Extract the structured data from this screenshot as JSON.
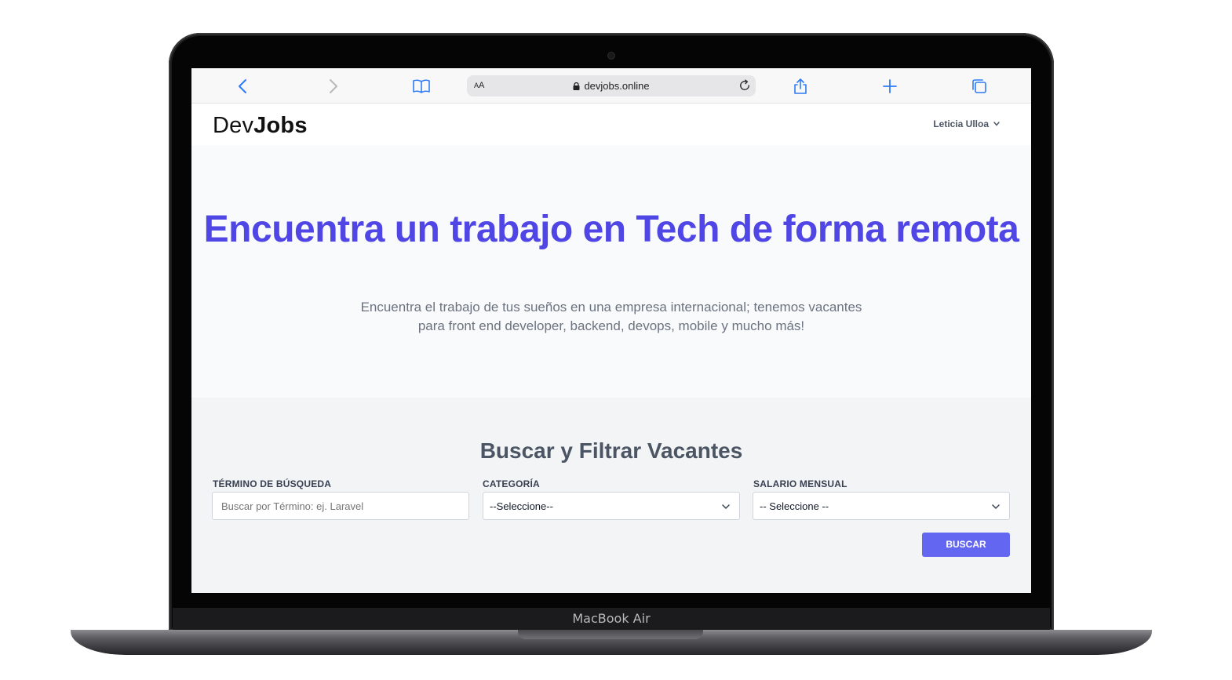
{
  "device": {
    "brand": "MacBook Air"
  },
  "browser": {
    "text_size_label_a": "A",
    "text_size_label_b": "A",
    "url": "devjobs.online",
    "accent_color": "#2f7bf5"
  },
  "header": {
    "logo_light": "Dev",
    "logo_bold": "Jobs",
    "user_name": "Leticia Ulloa"
  },
  "hero": {
    "title": "Encuentra un trabajo en Tech de forma remota",
    "subtitle": "Encuentra el trabajo de tus sueños en una empresa internacional; tenemos vacantes para front end developer, backend, devops, mobile y mucho más!",
    "title_color": "#4f46e5"
  },
  "search": {
    "title": "Buscar y Filtrar Vacantes",
    "term_label": "TÉRMINO DE BÚSQUEDA",
    "term_placeholder": "Buscar por Término: ej. Laravel",
    "category_label": "CATEGORÍA",
    "category_value": "--Seleccione--",
    "salary_label": "SALARIO MENSUAL",
    "salary_value": "-- Seleccione --",
    "button_label": "BUSCAR",
    "button_color": "#6366f1"
  }
}
